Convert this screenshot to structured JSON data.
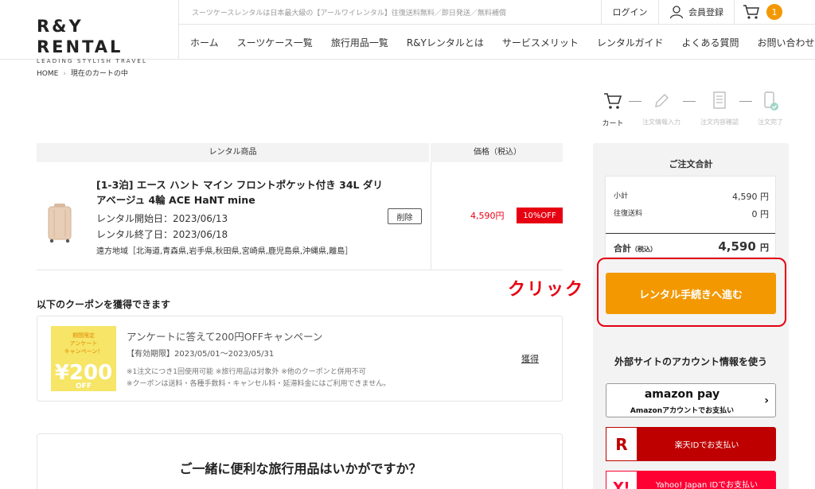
{
  "header": {
    "logo_main": "R&Y RENTAL",
    "logo_sub": "LEADING STYLISH TRAVEL",
    "tagline": "スーツケースレンタルは日本最大級の【アールワイレンタル】往復送料無料／即日発送／無料補償",
    "login": "ログイン",
    "register": "会員登録",
    "cart_count": "1"
  },
  "nav": [
    "ホーム",
    "スーツケース一覧",
    "旅行用品一覧",
    "R&Yレンタルとは",
    "サービスメリット",
    "レンタルガイド",
    "よくある質問",
    "お問い合わせ"
  ],
  "breadcrumb": {
    "home": "HOME",
    "sep": "›",
    "current": "現在のカートの中"
  },
  "steps": {
    "cart": "カート",
    "info": "注文情報入力",
    "confirm": "注文内容確認",
    "complete": "注文完了"
  },
  "table": {
    "col_product": "レンタル商品",
    "col_price": "価格（税込）"
  },
  "product": {
    "name": "[1-3泊] エース ハント マイン フロントポケット付き 34L ダリアベージュ 4輪 ACE HaNT mine",
    "start": "レンタル開始日：2023/06/13",
    "end": "レンタル終了日：2023/06/18",
    "remote": "遠方地域［北海道,青森県,岩手県,秋田県,宮崎県,鹿児島県,沖縄県,離島］",
    "delete": "削除",
    "price": "4,590円",
    "discount": "10%OFF"
  },
  "coupon": {
    "section_title": "以下のクーポンを獲得できます",
    "img_line1": "期間限定",
    "img_line2": "アンケート",
    "img_line3": "キャンペーン！",
    "img_amount": "¥200",
    "img_off": "OFF",
    "name": "アンケートに答えて200円OFFキャンペーン",
    "period": "【有効期限】2023/05/01～2023/05/31",
    "note1": "※1注文につき1回使用可能 ※旅行用品は対象外 ※他のクーポンと併用不可",
    "note2": "※クーポンは送料・各種手数料・キャンセル料・延滞料金にはご利用できません。",
    "get": "獲得"
  },
  "suggest": {
    "title": "ご一緒に便利な旅行用品はいかがですか？"
  },
  "summary": {
    "title": "ご注文合計",
    "subtotal_label": "小計",
    "subtotal_value": "4,590 円",
    "shipping_label": "往復送料",
    "shipping_value": "0 円",
    "total_label": "合計",
    "total_tax": "（税込）",
    "total_value": "4,590",
    "total_unit": "円",
    "cta": "レンタル手続きへ進む",
    "click_annotation": "クリック",
    "external_title": "外部サイトのアカウント情報を使う",
    "amazon_brand": "amazon pay",
    "amazon_sub": "Amazonアカウントでお支払い",
    "rakuten_icon": "R",
    "rakuten_label": "楽天IDでお支払い",
    "yahoo_icon": "Y!",
    "yahoo_label": "Yahoo! Japan IDでお支払い"
  },
  "colors": {
    "accent_orange": "#f39800",
    "red": "#e60012",
    "rakuten": "#bf0000",
    "yahoo": "#ff0033"
  }
}
